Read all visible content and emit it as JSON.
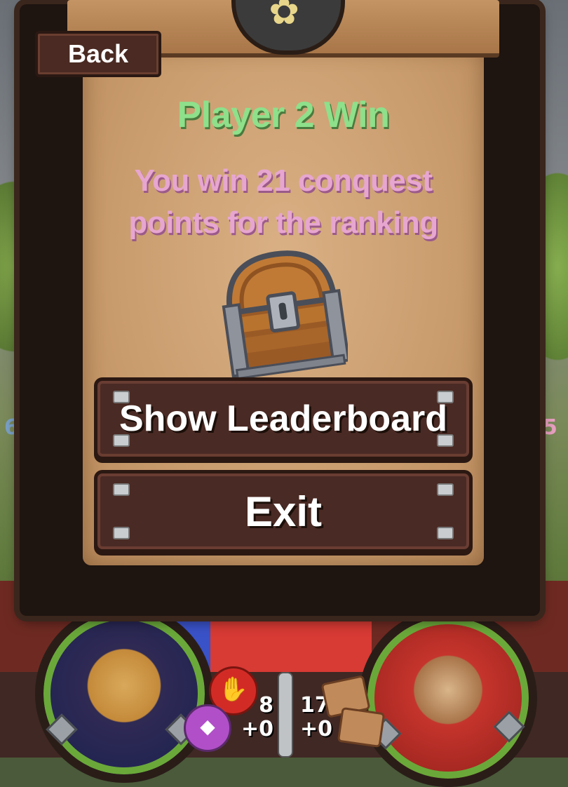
{
  "modal": {
    "back_label": "Back",
    "title": "Player 2 Win",
    "message_line1": "You win 21 conquest",
    "message_line2": "points for the ranking",
    "reward_icon": "treasure-chest",
    "buttons": {
      "leaderboard_label": "Show Leaderboard",
      "exit_label": "Exit"
    }
  },
  "background": {
    "left_edge_number": "6",
    "right_edge_number": "5"
  },
  "hud": {
    "player1": {
      "portrait": "blonde-warrior-woman"
    },
    "player2": {
      "portrait": "wizard-hat-bandit"
    },
    "stop_icon": "hand-stop-icon",
    "left_stats": {
      "value": "8",
      "delta": "+0"
    },
    "right_stats": {
      "value": "17",
      "delta": "+0"
    }
  },
  "colors": {
    "title": "#8ee08a",
    "message": "#e7a6d0",
    "button_bg": "#4a2a24",
    "parchment": "#c99c6d"
  }
}
